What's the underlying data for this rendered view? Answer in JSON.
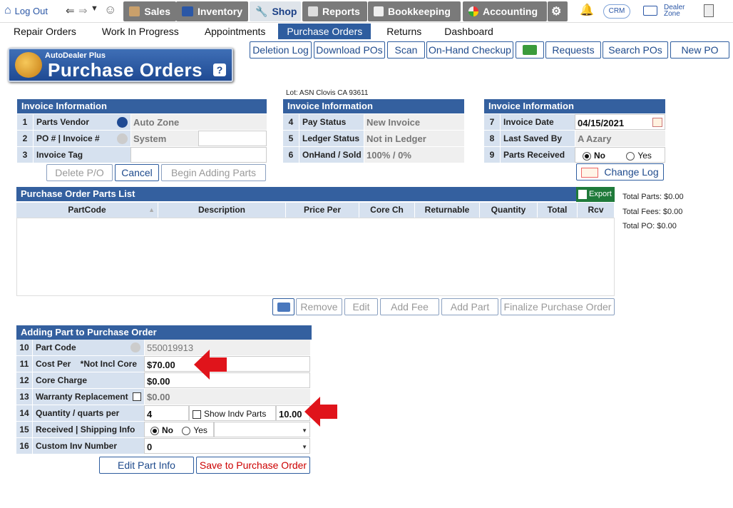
{
  "topnav": {
    "logout": "Log Out",
    "items": [
      {
        "label": "Sales",
        "icon": "sales-icon"
      },
      {
        "label": "Inventory",
        "icon": "car-icon"
      },
      {
        "label": "Shop",
        "icon": "wrench-icon"
      },
      {
        "label": "Reports",
        "icon": "report-icon"
      },
      {
        "label": "Bookkeeping",
        "icon": "book-icon"
      },
      {
        "label": "Accounting",
        "icon": "pie-icon"
      }
    ],
    "crm": "CRM",
    "dealer_zone": [
      "Dealer",
      "Zone"
    ]
  },
  "subnav": [
    "Repair Orders",
    "Work In Progress",
    "Appointments",
    "Purchase Orders",
    "Returns",
    "Dashboard"
  ],
  "toolbar": [
    "Deletion Log",
    "Download POs",
    "Scan",
    "On-Hand Checkup",
    "Requests",
    "Search POs",
    "New PO"
  ],
  "logo": {
    "small": "AutoDealer Plus",
    "title": "Purchase Orders",
    "help": "?"
  },
  "lot": "Lot: ASN Clovis CA 93611",
  "panel1": {
    "title": "Invoice Information",
    "rows": [
      {
        "n": "1",
        "label": "Parts Vendor",
        "value": "Auto Zone"
      },
      {
        "n": "2",
        "label": "PO # |   Invoice #",
        "value": "System"
      },
      {
        "n": "3",
        "label": "Invoice Tag",
        "value": ""
      }
    ],
    "buttons": [
      "Delete P/O",
      "Cancel",
      "Begin Adding Parts"
    ]
  },
  "panel2": {
    "title": "Invoice Information",
    "rows": [
      {
        "n": "4",
        "label": "Pay Status",
        "value": "New Invoice"
      },
      {
        "n": "5",
        "label": "Ledger Status",
        "value": "Not in Ledger"
      },
      {
        "n": "6",
        "label": "OnHand / Sold",
        "value": "100% / 0%"
      }
    ]
  },
  "panel3": {
    "title": "Invoice Information",
    "rows": [
      {
        "n": "7",
        "label": "Invoice Date",
        "value": "04/15/2021"
      },
      {
        "n": "8",
        "label": "Last Saved By",
        "value": "A Azary"
      },
      {
        "n": "9",
        "label": "Parts Received",
        "no": "No",
        "yes": "Yes"
      }
    ],
    "change_log": "Change Log"
  },
  "parts_list": {
    "title": "Purchase Order Parts List",
    "export": "Export",
    "columns": [
      "PartCode",
      "Description",
      "Price Per",
      "Core Ch",
      "Returnable",
      "Quantity",
      "Total",
      "Rcv"
    ],
    "buttons": [
      "Remove",
      "Edit",
      "Add Fee",
      "Add Part",
      "Finalize Purchase Order"
    ]
  },
  "totals": [
    "Total Parts: $0.00",
    "Total Fees: $0.00",
    "Total PO: $0.00"
  ],
  "adding": {
    "title": "Adding Part to Purchase Order",
    "rows": [
      {
        "n": "10",
        "label": "Part Code",
        "value": "550019913"
      },
      {
        "n": "11",
        "label": "Cost Per    *Not Incl Core",
        "value": "$70.00"
      },
      {
        "n": "12",
        "label": "Core Charge",
        "value": "$0.00"
      },
      {
        "n": "13",
        "label": "Warranty Replacement",
        "value": "$0.00"
      },
      {
        "n": "14",
        "label": "Quantity / quarts per",
        "value": "4",
        "show_indv": "Show Indv Parts",
        "per": "10.00"
      },
      {
        "n": "15",
        "label": "Received | Shipping Info",
        "no": "No",
        "yes": "Yes"
      },
      {
        "n": "16",
        "label": "Custom Inv Number",
        "value": "0"
      }
    ],
    "buttons": [
      "Edit Part Info",
      "Save to Purchase Order"
    ]
  },
  "colors": {
    "header": "#34609f",
    "cell": "#d6e1ef",
    "accent_red": "#e0141b"
  }
}
